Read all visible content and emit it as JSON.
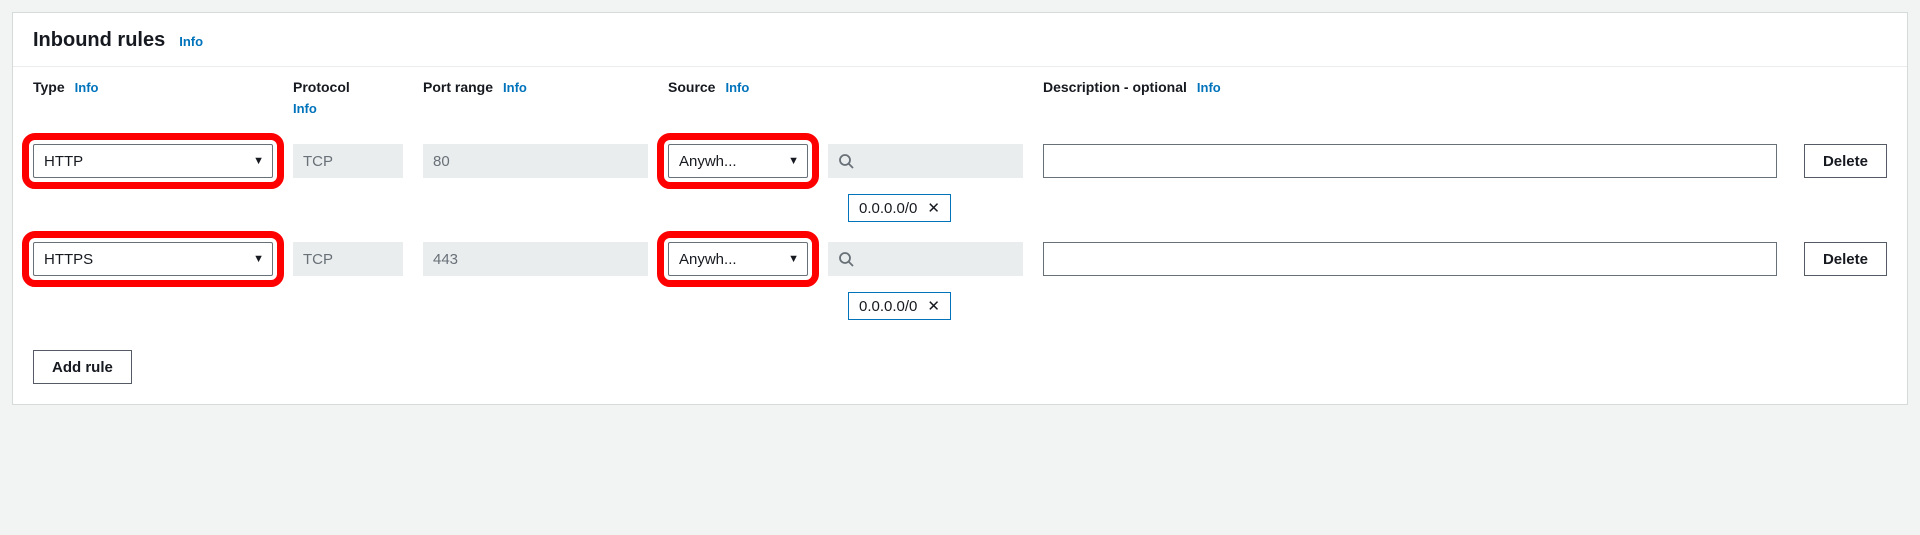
{
  "panel": {
    "title": "Inbound rules",
    "info_link": "Info"
  },
  "columns": {
    "type": "Type",
    "protocol": "Protocol",
    "port_range": "Port range",
    "source": "Source",
    "description": "Description - optional"
  },
  "info_link_label": "Info",
  "rules": [
    {
      "type": "HTTP",
      "protocol": "TCP",
      "port_range": "80",
      "source_mode": "Anywh...",
      "cidr": "0.0.0.0/0",
      "description": ""
    },
    {
      "type": "HTTPS",
      "protocol": "TCP",
      "port_range": "443",
      "source_mode": "Anywh...",
      "cidr": "0.0.0.0/0",
      "description": ""
    }
  ],
  "buttons": {
    "delete": "Delete",
    "add_rule": "Add rule"
  }
}
